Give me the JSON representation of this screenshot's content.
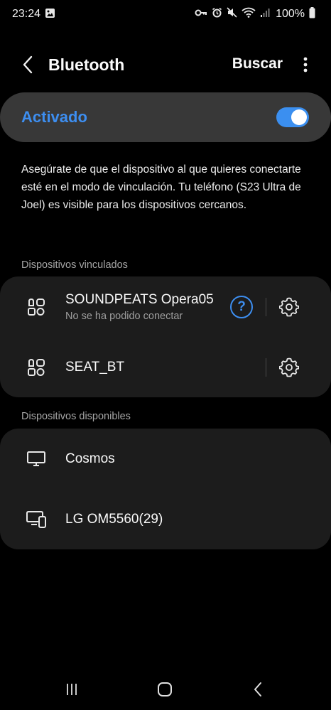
{
  "status_bar": {
    "time": "23:24",
    "battery": "100%",
    "icons": [
      "image-icon",
      "vpn-key-icon",
      "alarm-icon",
      "mute-icon",
      "wifi-icon",
      "signal-icon"
    ]
  },
  "app_bar": {
    "title": "Bluetooth",
    "search_label": "Buscar"
  },
  "master_switch": {
    "label": "Activado",
    "on": true,
    "accent_color": "#3d8ef0"
  },
  "description": "Asegúrate de que el dispositivo al que quieres conectarte esté en el modo de vinculación. Tu teléfono (S23 Ultra de Joel) es visible para los dispositivos cercanos.",
  "paired": {
    "header": "Dispositivos vinculados",
    "devices": [
      {
        "name": "SOUNDPEATS Opera05",
        "status": "No se ha podido conectar",
        "icon": "audio-device-icon",
        "help": "?"
      },
      {
        "name": "SEAT_BT",
        "status": "",
        "icon": "audio-device-icon"
      }
    ]
  },
  "available": {
    "header": "Dispositivos disponibles",
    "devices": [
      {
        "name": "Cosmos",
        "icon": "monitor-icon"
      },
      {
        "name": "LG OM5560(29)",
        "icon": "multi-device-icon"
      }
    ]
  }
}
